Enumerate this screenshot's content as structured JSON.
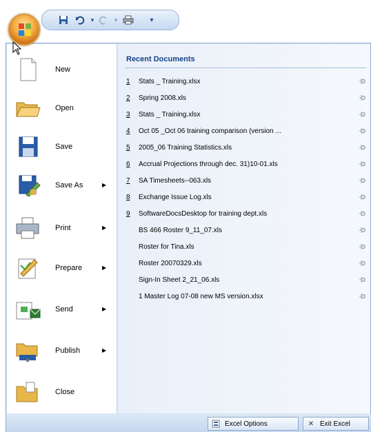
{
  "qat": {
    "save_icon": "save-icon",
    "undo_icon": "undo-icon",
    "redo_icon": "redo-icon",
    "print_icon": "print-icon",
    "customize_icon": "customize-quick-access-icon"
  },
  "menu": {
    "items": [
      {
        "label": "New",
        "icon": "new-document-icon",
        "has_arrow": false
      },
      {
        "label": "Open",
        "icon": "folder-open-icon",
        "has_arrow": false
      },
      {
        "label": "Save",
        "icon": "save-icon",
        "has_arrow": false
      },
      {
        "label": "Save As",
        "icon": "save-as-icon",
        "has_arrow": true
      },
      {
        "label": "Print",
        "icon": "printer-icon",
        "has_arrow": true
      },
      {
        "label": "Prepare",
        "icon": "prepare-icon",
        "has_arrow": true
      },
      {
        "label": "Send",
        "icon": "send-icon",
        "has_arrow": true
      },
      {
        "label": "Publish",
        "icon": "publish-icon",
        "has_arrow": true
      },
      {
        "label": "Close",
        "icon": "close-folder-icon",
        "has_arrow": false
      }
    ]
  },
  "recent": {
    "title": "Recent Documents",
    "items": [
      {
        "num": "1",
        "name": "Stats _ Training.xlsx"
      },
      {
        "num": "2",
        "name": "Spring 2008.xls"
      },
      {
        "num": "3",
        "name": "Stats _ Training.xlsx"
      },
      {
        "num": "4",
        "name": "Oct 05 _Oct 06 training comparison (version ..."
      },
      {
        "num": "5",
        "name": "2005_06 Training Statistics.xls"
      },
      {
        "num": "6",
        "name": "Accrual Projections through dec. 31)10-01.xls"
      },
      {
        "num": "7",
        "name": "SA Timesheets--063.xls"
      },
      {
        "num": "8",
        "name": "Exchange Issue Log.xls"
      },
      {
        "num": "9",
        "name": "SoftwareDocsDesktop for training dept.xls"
      },
      {
        "num": "",
        "name": "BS 466  Roster 9_11_07.xls"
      },
      {
        "num": "",
        "name": "Roster for Tina.xls"
      },
      {
        "num": "",
        "name": "Roster 20070329.xls"
      },
      {
        "num": "",
        "name": "Sign-In Sheet 2_21_06.xls"
      },
      {
        "num": "",
        "name": "1 Master Log 07-08 new MS version.xlsx"
      }
    ]
  },
  "footer": {
    "options_label": "Excel Options",
    "exit_label": "Exit Excel"
  }
}
